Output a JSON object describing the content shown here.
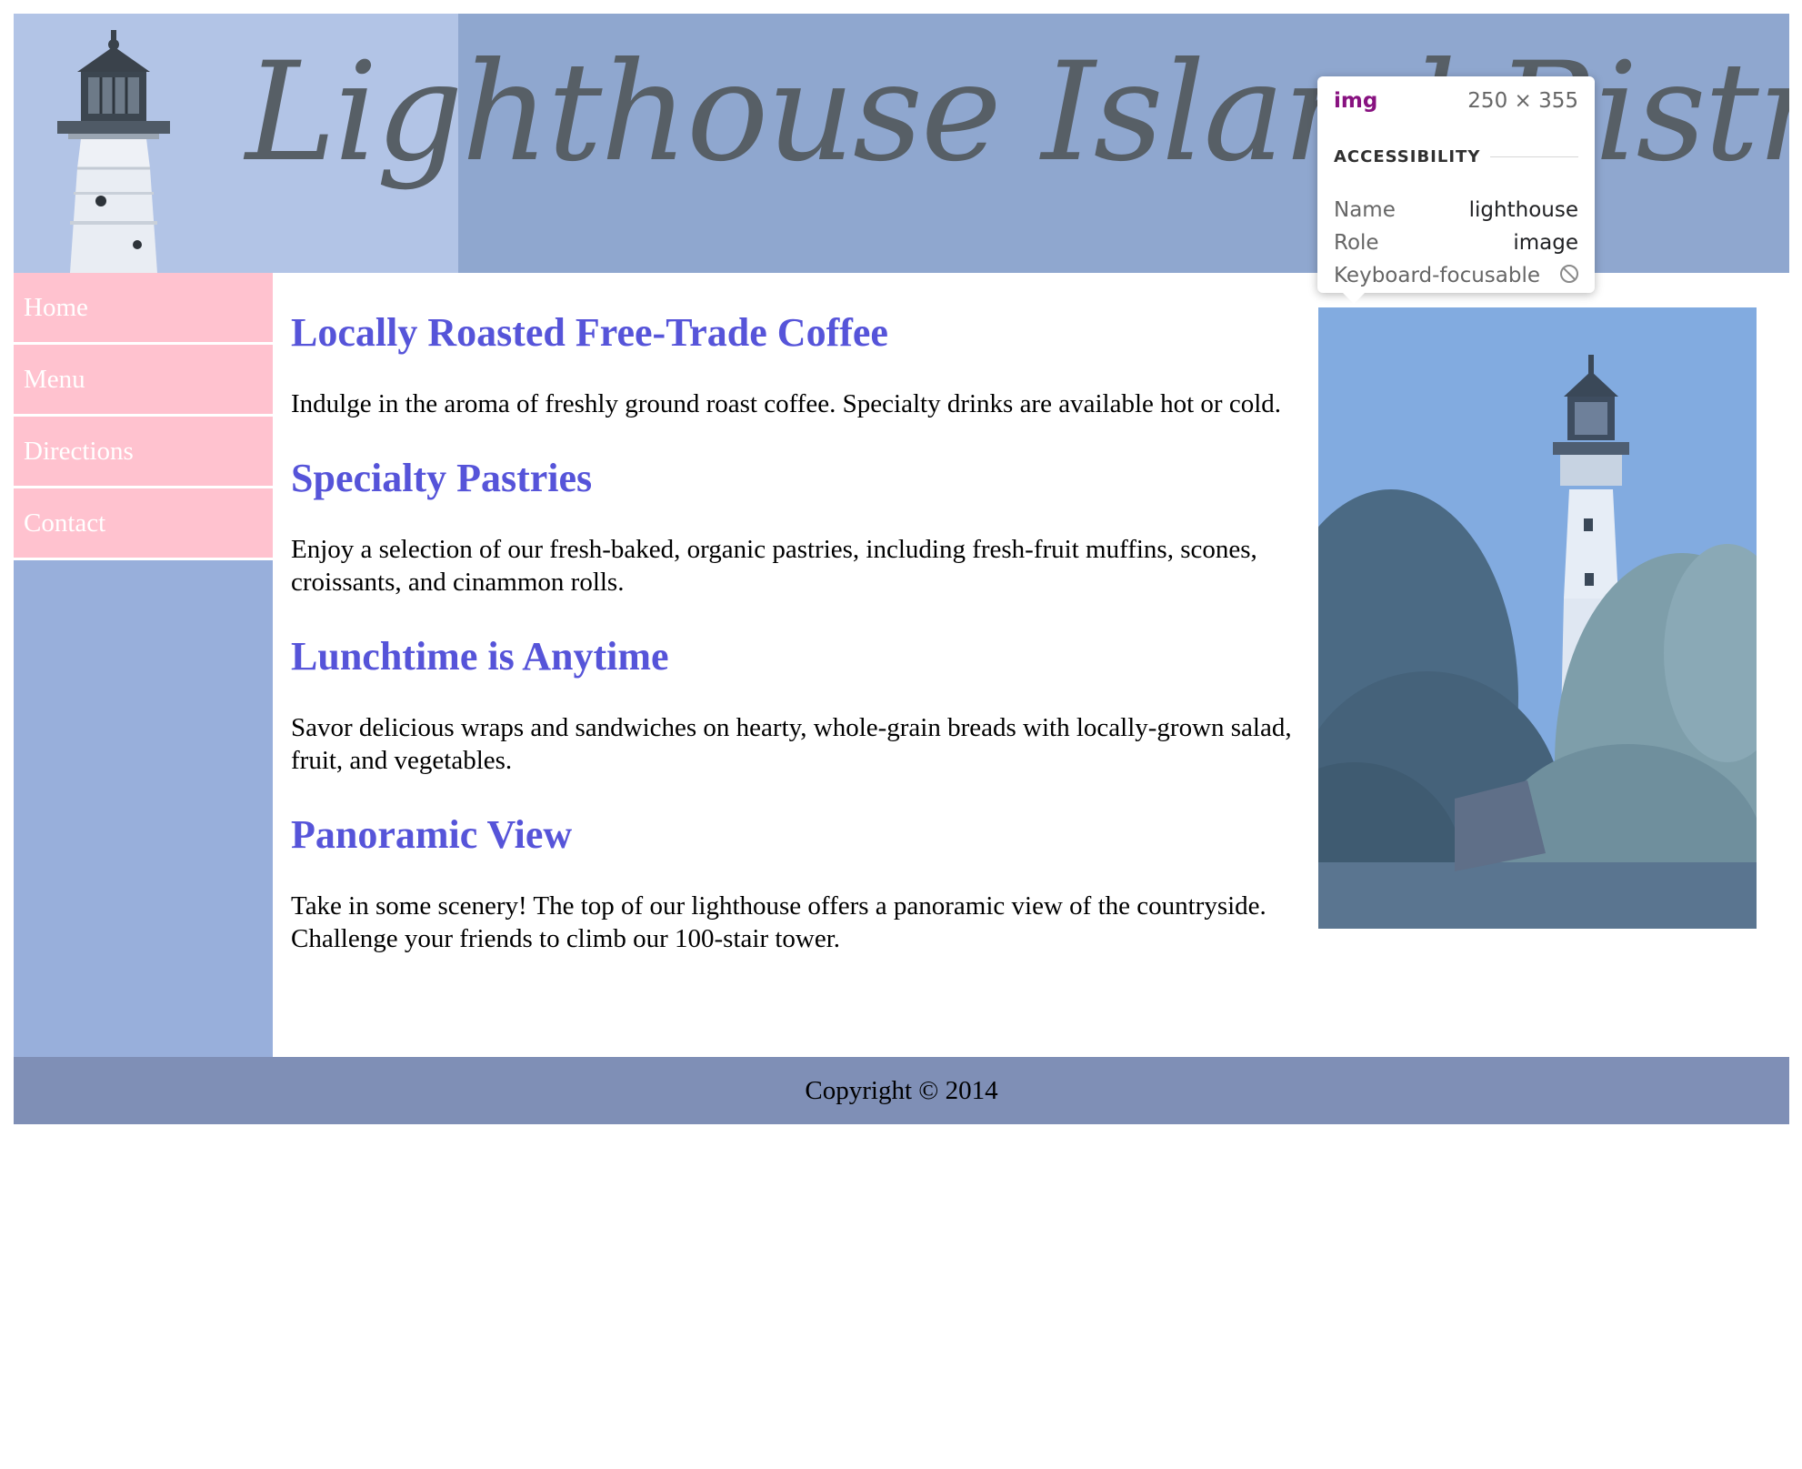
{
  "header": {
    "title": "Lighthouse Island Bistro",
    "banner_image": "lighthouse-banner"
  },
  "nav": {
    "items": [
      {
        "label": "Home"
      },
      {
        "label": "Menu"
      },
      {
        "label": "Directions"
      },
      {
        "label": "Contact"
      }
    ]
  },
  "content": {
    "sections": [
      {
        "heading": "Locally Roasted Free-Trade Coffee",
        "text": "Indulge in the aroma of freshly ground roast coffee. Specialty drinks are available hot or cold."
      },
      {
        "heading": "Specialty Pastries",
        "text": "Enjoy a selection of our fresh-baked, organic pastries, including fresh-fruit muffins, scones, croissants, and cinammon rolls."
      },
      {
        "heading": "Lunchtime is Anytime",
        "text": "Savor delicious wraps and sandwiches on hearty, whole-grain breads with locally-grown salad, fruit, and vegetables."
      },
      {
        "heading": "Panoramic View",
        "text": "Take in some scenery! The top of our lighthouse offers a panoramic view of the countryside. Challenge your friends to climb our 100-stair tower."
      }
    ]
  },
  "side_image": {
    "alt": "lighthouse"
  },
  "footer": {
    "copyright": "Copyright © 2014"
  },
  "devtools_tooltip": {
    "tag": "img",
    "dimensions": "250 × 355",
    "section_title": "ACCESSIBILITY",
    "rows": [
      {
        "key": "Name",
        "value": "lighthouse"
      },
      {
        "key": "Role",
        "value": "image"
      },
      {
        "key": "Keyboard-focusable",
        "value": ""
      }
    ]
  },
  "colors": {
    "header_bg": "#8fa7cf",
    "nav_bg": "#98afdb",
    "nav_item_bg": "#ffc2cf",
    "heading": "#5654d9",
    "footer_bg": "#7f8fb6",
    "tooltip_tag": "#881280"
  }
}
